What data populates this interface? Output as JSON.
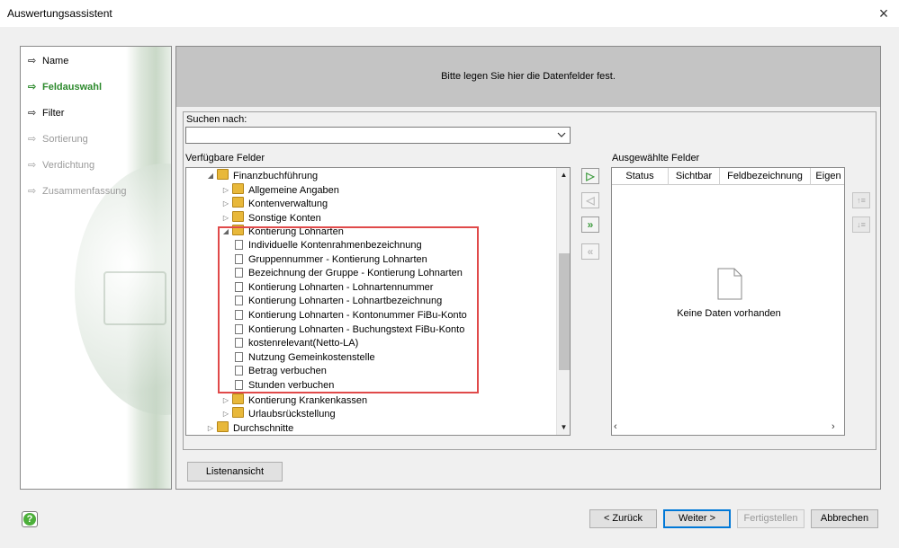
{
  "window": {
    "title": "Auswertungsassistent",
    "close_icon": "×"
  },
  "nav": {
    "items": [
      {
        "label": "Name",
        "state": "normal"
      },
      {
        "label": "Feldauswahl",
        "state": "active"
      },
      {
        "label": "Filter",
        "state": "normal"
      },
      {
        "label": "Sortierung",
        "state": "disabled"
      },
      {
        "label": "Verdichtung",
        "state": "disabled"
      },
      {
        "label": "Zusammenfassung",
        "state": "disabled"
      }
    ]
  },
  "header": {
    "text": "Bitte legen Sie hier die Datenfelder fest."
  },
  "search": {
    "label": "Suchen nach:",
    "value": ""
  },
  "available": {
    "label": "Verfügbare Felder",
    "tree": [
      {
        "label": "Finanzbuchführung",
        "type": "folder",
        "expanded": true,
        "level": 1
      },
      {
        "label": "Allgemeine Angaben",
        "type": "folder",
        "expanded": false,
        "level": 2
      },
      {
        "label": "Kontenverwaltung",
        "type": "folder",
        "expanded": false,
        "level": 2
      },
      {
        "label": "Sonstige Konten",
        "type": "folder",
        "expanded": false,
        "level": 2
      },
      {
        "label": "Kontierung Lohnarten",
        "type": "folder",
        "expanded": true,
        "level": 2
      },
      {
        "label": "Individuelle Kontenrahmenbezeichnung",
        "type": "field",
        "level": 3
      },
      {
        "label": "Gruppennummer - Kontierung Lohnarten",
        "type": "field",
        "level": 3
      },
      {
        "label": "Bezeichnung der Gruppe - Kontierung Lohnarten",
        "type": "field",
        "level": 3
      },
      {
        "label": "Kontierung Lohnarten - Lohnartennummer",
        "type": "field",
        "level": 3
      },
      {
        "label": "Kontierung Lohnarten - Lohnartbezeichnung",
        "type": "field",
        "level": 3
      },
      {
        "label": "Kontierung Lohnarten - Kontonummer FiBu-Konto",
        "type": "field",
        "level": 3
      },
      {
        "label": "Kontierung Lohnarten - Buchungstext FiBu-Konto",
        "type": "field",
        "level": 3
      },
      {
        "label": "kostenrelevant(Netto-LA)",
        "type": "field",
        "level": 3
      },
      {
        "label": "Nutzung Gemeinkostenstelle",
        "type": "field",
        "level": 3
      },
      {
        "label": "Betrag verbuchen",
        "type": "field",
        "level": 3
      },
      {
        "label": "Stunden verbuchen",
        "type": "field",
        "level": 3
      },
      {
        "label": "Kontierung Krankenkassen",
        "type": "folder",
        "expanded": false,
        "level": 2
      },
      {
        "label": "Urlaubsrückstellung",
        "type": "folder",
        "expanded": false,
        "level": 2
      },
      {
        "label": "Durchschnitte",
        "type": "folder",
        "expanded": false,
        "level": 1
      }
    ]
  },
  "move_buttons": [
    {
      "icon": "move-right-icon",
      "glyph": "▷",
      "enabled": true
    },
    {
      "icon": "move-left-icon",
      "glyph": "◁",
      "enabled": false
    },
    {
      "icon": "move-all-right-icon",
      "glyph": "»",
      "enabled": true
    },
    {
      "icon": "move-all-left-icon",
      "glyph": "«",
      "enabled": false
    }
  ],
  "selected": {
    "label": "Ausgewählte Felder",
    "columns": [
      "Status",
      "Sichtbar",
      "Feldbezeichnung",
      "Eigen"
    ],
    "empty_text": "Keine Daten vorhanden"
  },
  "buttons": {
    "list_view": "Listenansicht",
    "back": "< Zurück",
    "next": "Weiter >",
    "finish": "Fertigstellen",
    "cancel": "Abbrechen"
  },
  "colors": {
    "active_nav": "#2d8a2d",
    "highlight": "#e04a4a",
    "header_band": "#c4c4c4"
  }
}
